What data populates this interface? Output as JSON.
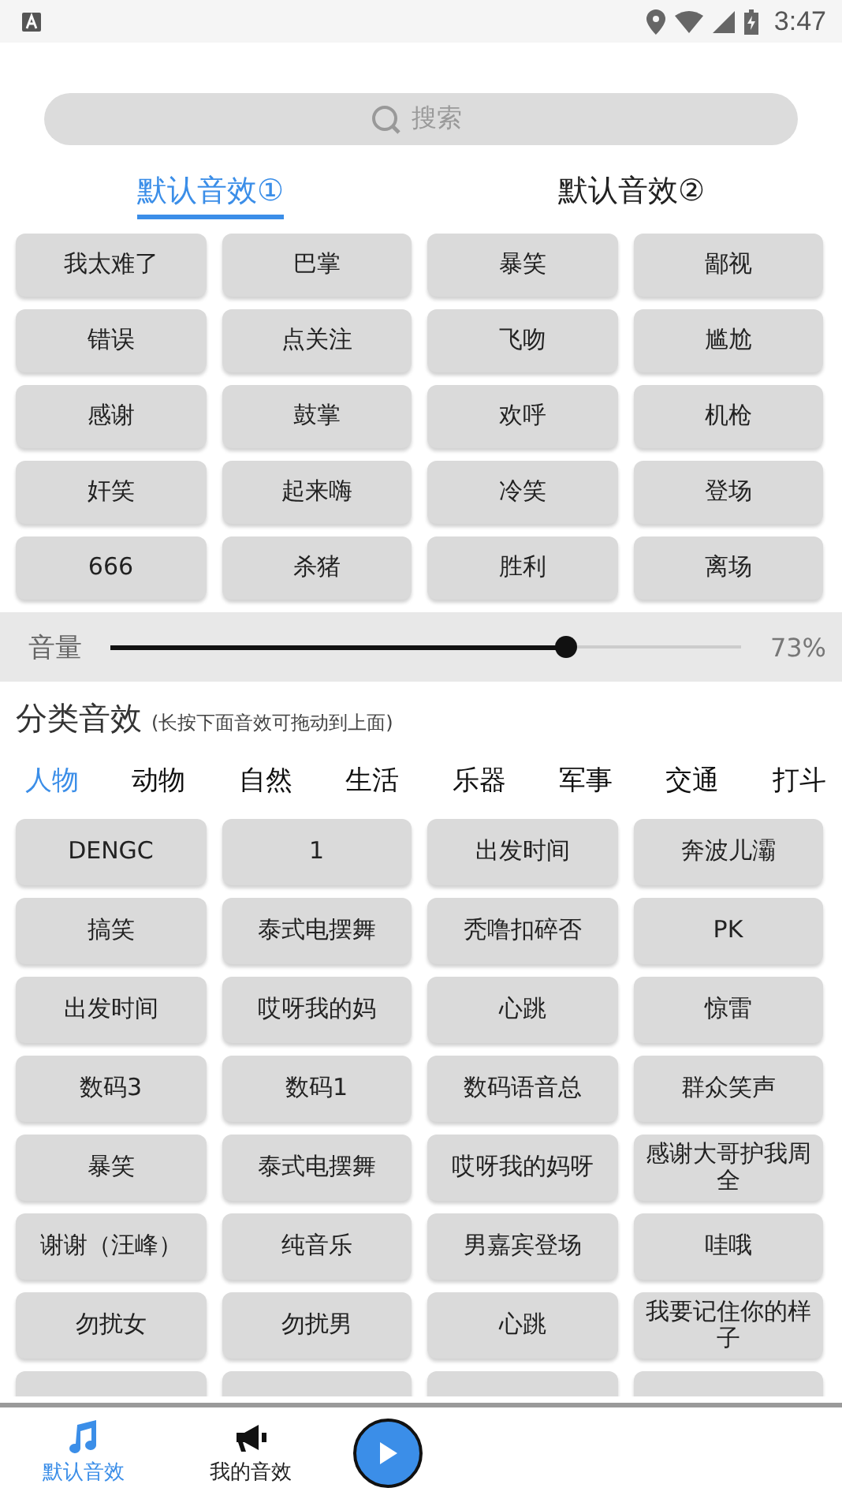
{
  "status_bar": {
    "time": "3:47"
  },
  "search": {
    "placeholder": "搜索"
  },
  "tabs": [
    {
      "label": "默认音效①",
      "selected": true
    },
    {
      "label": "默认音效②",
      "selected": false
    }
  ],
  "top_sounds": [
    "我太难了",
    "巴掌",
    "暴笑",
    "鄙视",
    "错误",
    "点关注",
    "飞吻",
    "尴尬",
    "感谢",
    "鼓掌",
    "欢呼",
    "机枪",
    "奸笑",
    "起来嗨",
    "冷笑",
    "登场",
    "666",
    "杀猪",
    "胜利",
    "离场"
  ],
  "volume": {
    "label": "音量",
    "level": 0.73,
    "reading": "73%"
  },
  "category_section": {
    "title": "分类音效",
    "hint": "(长按下面音效可拖动到上面)"
  },
  "categories": [
    {
      "label": "人物",
      "selected": true
    },
    {
      "label": "动物",
      "selected": false
    },
    {
      "label": "自然",
      "selected": false
    },
    {
      "label": "生活",
      "selected": false
    },
    {
      "label": "乐器",
      "selected": false
    },
    {
      "label": "军事",
      "selected": false
    },
    {
      "label": "交通",
      "selected": false
    },
    {
      "label": "打斗",
      "selected": false
    }
  ],
  "category_sounds": [
    "DENGC",
    "1",
    "出发时间",
    "奔波儿灞",
    "搞笑",
    "泰式电摆舞",
    "秃噜扣碎否",
    "PK",
    "出发时间",
    "哎呀我的妈",
    "心跳",
    "惊雷",
    "数码3",
    "数码1",
    "数码语音总",
    "群众笑声",
    "暴笑",
    "泰式电摆舞",
    "哎呀我的妈呀",
    "感谢大哥护我周全",
    "谢谢（汪峰）",
    "纯音乐",
    "男嘉宾登场",
    "哇哦",
    "勿扰女",
    "勿扰男",
    "心跳",
    "我要记住你的样子"
  ],
  "bottom_nav": [
    {
      "kind": "music",
      "label": "默认音效",
      "selected": true
    },
    {
      "kind": "megaphone",
      "label": "我的音效",
      "selected": false
    },
    {
      "kind": "play"
    }
  ]
}
